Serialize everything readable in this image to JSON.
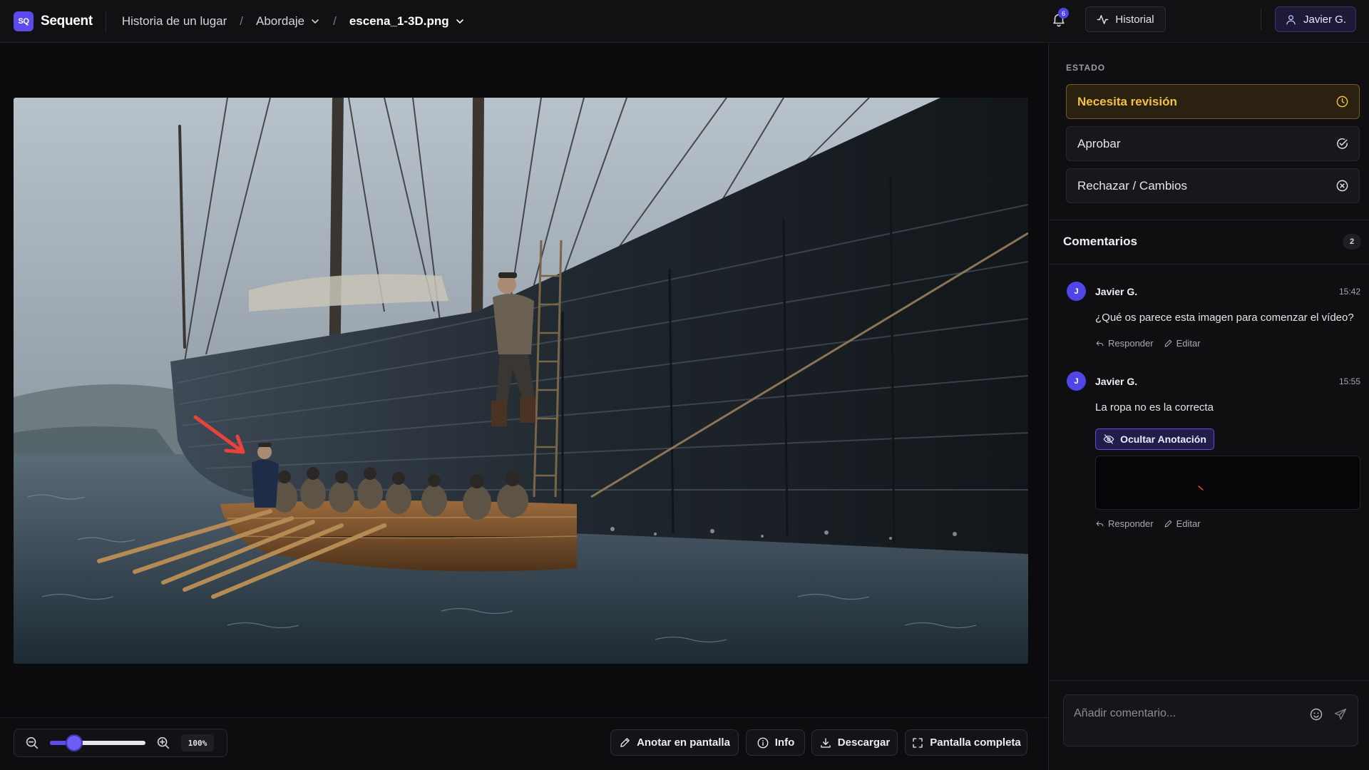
{
  "app": {
    "logo_mark": "SQ",
    "name": "Sequent"
  },
  "breadcrumb": {
    "project": "Historia de un lugar",
    "separator": "/",
    "scene": "Abordaje",
    "file": "escena_1-3D.png"
  },
  "header": {
    "notification_count": "6",
    "history_label": "Historial",
    "user_label": "Javier G."
  },
  "viewer": {
    "zoom_label": "100%",
    "zoom_slider_fraction": 0.25
  },
  "toolbar": {
    "annotate": "Anotar en pantalla",
    "info": "Info",
    "download": "Descargar",
    "fullscreen": "Pantalla completa"
  },
  "status": {
    "label": "ESTADO",
    "options": [
      {
        "label": "Necesita revisión",
        "icon": "clock-icon",
        "active": true
      },
      {
        "label": "Aprobar",
        "icon": "check-circle-icon",
        "active": false
      },
      {
        "label": "Rechazar / Cambios",
        "icon": "x-circle-icon",
        "active": false
      }
    ]
  },
  "comments": {
    "title": "Comentarios",
    "count": "2",
    "reply_label": "Responder",
    "edit_label": "Editar",
    "items": [
      {
        "initial": "J",
        "author": "Javier G.",
        "time": "15:42",
        "text": "¿Qué os parece esta imagen para comenzar el vídeo?"
      },
      {
        "initial": "J",
        "author": "Javier G.",
        "time": "15:55",
        "text": "La ropa no es la correcta",
        "annotation_button": "Ocultar Anotación"
      }
    ],
    "composer_placeholder": "Añadir comentario..."
  },
  "colors": {
    "accent": "#5b4bea",
    "warning": "#f3c046",
    "annotation_arrow": "#e8433b"
  }
}
